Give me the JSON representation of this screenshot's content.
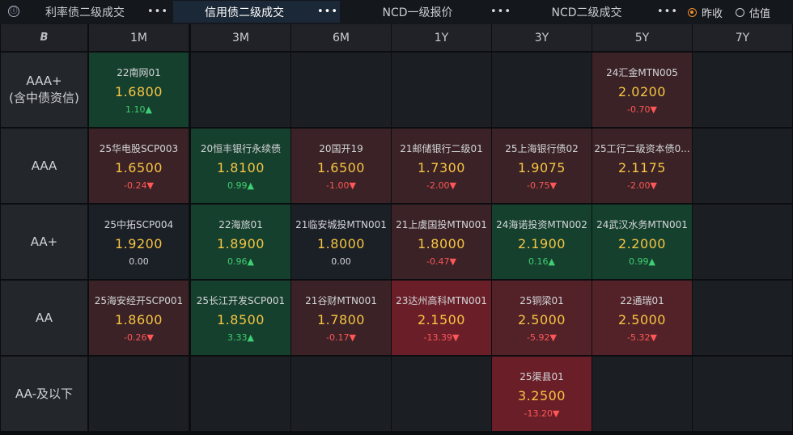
{
  "tabs": [
    {
      "label": "利率债二级成交",
      "active": false
    },
    {
      "label": "信用债二级成交",
      "active": true
    },
    {
      "label": "NCD一级报价",
      "active": false
    },
    {
      "label": "NCD二级成交",
      "active": false
    }
  ],
  "more_label": "•••",
  "info_icon": "ⓘ",
  "radio_options": [
    {
      "label": "昨收",
      "selected": true
    },
    {
      "label": "估值",
      "selected": false
    }
  ],
  "corner_label": "B",
  "terms": [
    "1M",
    "3M",
    "6M",
    "1Y",
    "3Y",
    "5Y",
    "7Y"
  ],
  "ratings": [
    "AAA+\n(含中债资信)",
    "AAA",
    "AA+",
    "AA",
    "AA-及以下"
  ],
  "cells": [
    [
      {
        "name": "22南网01",
        "yield": "1.6800",
        "change": "1.10",
        "dir": "up",
        "tone": "g"
      },
      null,
      null,
      null,
      null,
      {
        "name": "24汇金MTN005",
        "yield": "2.0200",
        "change": "-0.70",
        "dir": "down",
        "tone": "r1"
      },
      null
    ],
    [
      {
        "name": "25华电股SCP003",
        "yield": "1.6500",
        "change": "-0.24",
        "dir": "down",
        "tone": "r1"
      },
      {
        "name": "20恒丰银行永续债",
        "yield": "1.8100",
        "change": "0.99",
        "dir": "up",
        "tone": "g"
      },
      {
        "name": "20国开19",
        "yield": "1.6500",
        "change": "-1.00",
        "dir": "down",
        "tone": "r1"
      },
      {
        "name": "21邮储银行二级01",
        "yield": "1.7300",
        "change": "-2.00",
        "dir": "down",
        "tone": "r1"
      },
      {
        "name": "25上海银行债02",
        "yield": "1.9075",
        "change": "-0.75",
        "dir": "down",
        "tone": "r1"
      },
      {
        "name": "25工行二级资本债0...",
        "yield": "2.1175",
        "change": "-2.00",
        "dir": "down",
        "tone": "r1"
      },
      null
    ],
    [
      {
        "name": "25中拓SCP004",
        "yield": "1.9200",
        "change": "0.00",
        "dir": "flat",
        "tone": "n"
      },
      {
        "name": "22海旅01",
        "yield": "1.8900",
        "change": "0.96",
        "dir": "up",
        "tone": "g"
      },
      {
        "name": "21临安城投MTN001",
        "yield": "1.8000",
        "change": "0.00",
        "dir": "flat",
        "tone": "n"
      },
      {
        "name": "21上虞国投MTN001",
        "yield": "1.8000",
        "change": "-0.47",
        "dir": "down",
        "tone": "r1"
      },
      {
        "name": "24海诺投资MTN002",
        "yield": "2.1900",
        "change": "0.16",
        "dir": "up",
        "tone": "g"
      },
      {
        "name": "24武汉水务MTN001",
        "yield": "2.2000",
        "change": "0.99",
        "dir": "up",
        "tone": "g"
      },
      null
    ],
    [
      {
        "name": "25海安经开SCP001",
        "yield": "1.8600",
        "change": "-0.26",
        "dir": "down",
        "tone": "r1"
      },
      {
        "name": "25长江开发SCP001",
        "yield": "1.8500",
        "change": "3.33",
        "dir": "up",
        "tone": "g"
      },
      {
        "name": "21谷财MTN001",
        "yield": "1.7800",
        "change": "-0.17",
        "dir": "down",
        "tone": "r1"
      },
      {
        "name": "23达州高科MTN001",
        "yield": "2.1500",
        "change": "-13.39",
        "dir": "down",
        "tone": "r3"
      },
      {
        "name": "25铜梁01",
        "yield": "2.5000",
        "change": "-5.92",
        "dir": "down",
        "tone": "r2"
      },
      {
        "name": "22通瑞01",
        "yield": "2.5000",
        "change": "-5.32",
        "dir": "down",
        "tone": "r2"
      },
      null
    ],
    [
      null,
      null,
      null,
      null,
      {
        "name": "25渠县01",
        "yield": "3.2500",
        "change": "-13.20",
        "dir": "down",
        "tone": "r3"
      },
      null,
      null
    ]
  ],
  "arrows": {
    "up": "▲",
    "down": "▼",
    "flat": ""
  }
}
